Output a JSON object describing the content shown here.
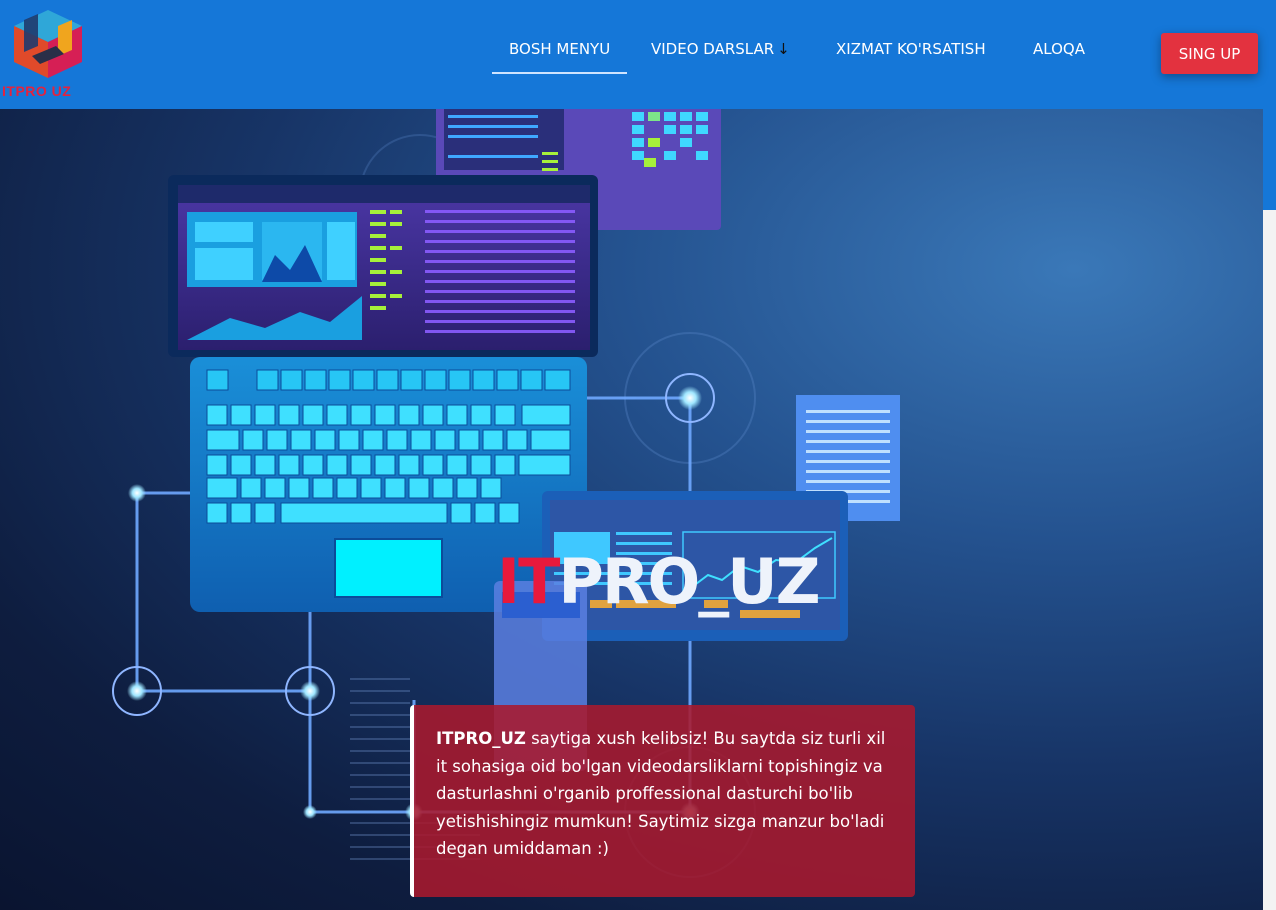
{
  "header": {
    "logo_text": "ITPRO UZ",
    "nav": [
      {
        "label": "BOSH MENYU",
        "active": true
      },
      {
        "label": "VIDEO DARSLAR",
        "icon": "arrow-down-icon",
        "icon_glyph": "↓"
      },
      {
        "label": "XIZMAT KO'RSATISH"
      },
      {
        "label": "ALOQA"
      }
    ],
    "signup_label": "SING UP"
  },
  "hero": {
    "title_accent": "IT",
    "title_rest": "PRO_UZ",
    "welcome_brand": "ITPRO_UZ",
    "welcome_text": " saytiga xush kelibsiz! Bu saytda siz turli xil it sohasiga oid bo'lgan videodarsliklarni topishingiz va dasturlashni o'rganib proffessional dasturchi bo'lib yetishishingiz mumkun! Saytimiz sizga manzur bo'ladi degan umiddaman :)"
  },
  "colors": {
    "navbar": "#1577d8",
    "signup": "#e3323f",
    "brand_red": "#e8193c",
    "welcome_box": "#a8192d"
  }
}
